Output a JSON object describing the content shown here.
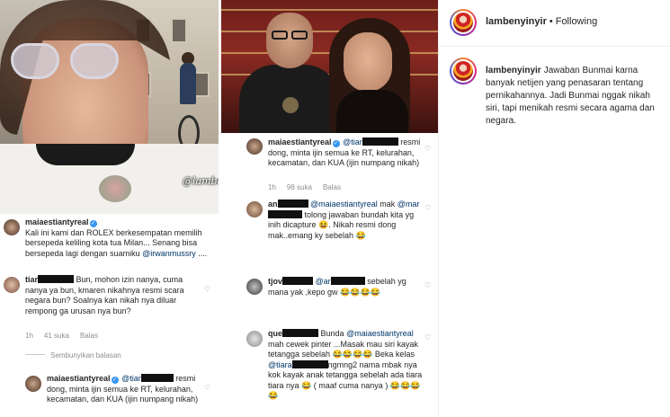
{
  "header": {
    "username": "lambenyinyir",
    "separator": "•",
    "follow_label": "Following"
  },
  "caption": {
    "username": "lambenyinyir",
    "text": "Jawaban Bunmai karna banyak netijen yang penasaran tentang pernikahannya. Jadi Bunmai nggak nikah siri, tapi menikah resmi secara agama dan negara."
  },
  "photo_left": {
    "watermark": "@lambenyinyir"
  },
  "comments_left": {
    "post": {
      "username": "maiaestiantyreal",
      "text": "Kali ini kami dan ROLEX berkesempatan memilih bersepeda keliling kota tua Milan... Senang bisa bersepeda lagi dengan suamiku",
      "mention": "@irwanmussry",
      "tail": "...."
    },
    "c1": {
      "username": "tiar",
      "text": "Bun, mohon izin nanya, cuma nanya ya bun, kmaren nikahnya resmi scara negara bun? Soalnya kan nikah nya diluar rempong ga urusan nya bun?",
      "time": "1h",
      "likes": "41 suka",
      "reply": "Balas"
    },
    "hide_replies": "Sembunyikan balasan",
    "c2": {
      "username": "maiaestiantyreal",
      "mention": "@tiar",
      "text": "resmi dong, minta ijin semua ke RT, kelurahan, kecamatan, dan KUA (ijin numpang nikah)"
    }
  },
  "comments_right": {
    "r1": {
      "username": "maiaestiantyreal",
      "mention": "@tiar",
      "text": "resmi dong, minta ijin semua ke RT, kelurahan, kecamatan, dan KUA (ijin numpang nikah)",
      "time": "1h",
      "likes": "98 suka",
      "reply": "Balas"
    },
    "r2": {
      "username": "an",
      "mention1": "@maiaestiantyreal",
      "word1": "mak",
      "mention2": "@mar",
      "text": "tolong jawaban bundah kita yg inih dicapture",
      "emoji": "😆",
      "reply_text": ". Nikah resmi dong mak..emang ky sebelah",
      "emoji2": "😂",
      "time": "1h",
      "likes": "50 suka",
      "reply": "Balas"
    },
    "r3": {
      "username": "tjov",
      "mention": "@ar",
      "text": "sebelah yg mana yak ,kepo gw",
      "emojis": "😂😂😂😂"
    },
    "r4": {
      "username": "que",
      "text1": "Bunda",
      "mention1": "@maiaestiantyreal",
      "text2": "mah cewek pinter ...Masak mau siri kayak tetangga sebelah",
      "emojis1": "😂😂😂😂",
      "text3": "Beka kelas",
      "mention2": "@tiara",
      "text4": "ngmng2 nama mbak nya kok kayak anak tetangga sebelah ada tiara tiara nya",
      "emojis2": "😂",
      "text5": "( maaf cuma nanya )",
      "emojis3": "😂😂😂😂"
    }
  },
  "colors": {
    "link": "#003569",
    "meta": "#8e8e8e",
    "verified": "#3897f0"
  }
}
